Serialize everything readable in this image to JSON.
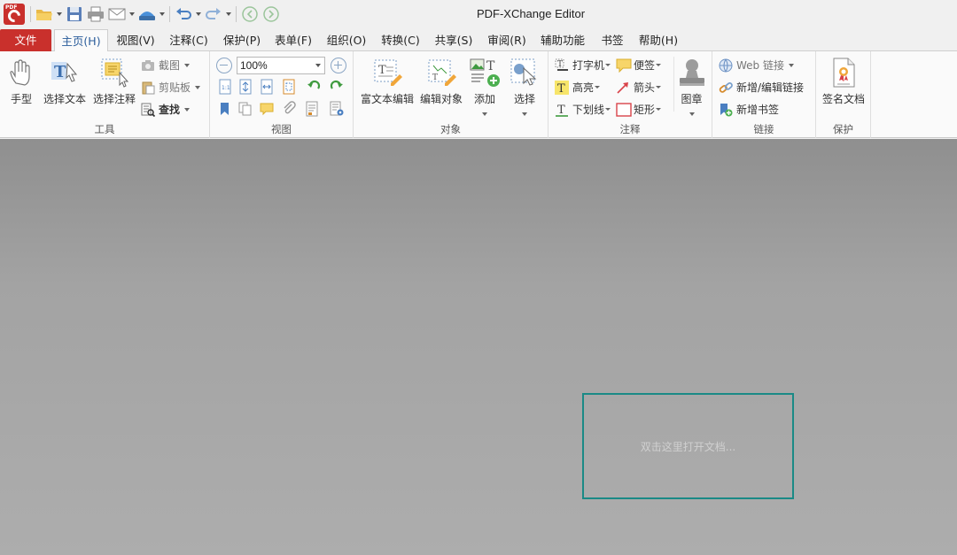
{
  "app": {
    "title": "PDF-XChange Editor",
    "logo_text": "PDF"
  },
  "quick_access": [
    {
      "name": "open-icon"
    },
    {
      "name": "save-icon"
    },
    {
      "name": "print-icon"
    },
    {
      "name": "email-icon"
    },
    {
      "name": "scan-icon"
    },
    {
      "name": "undo-icon"
    },
    {
      "name": "redo-icon"
    },
    {
      "name": "back-icon"
    },
    {
      "name": "forward-icon"
    }
  ],
  "menu_tabs": {
    "file": "文件",
    "home": "主页(H)",
    "view": "视图(V)",
    "comment": "注释(C)",
    "protect": "保护(P)",
    "form": "表单(F)",
    "organize": "组织(O)",
    "convert": "转换(C)",
    "share": "共享(S)",
    "review": "审阅(R)",
    "accessibility": "辅助功能",
    "bookmarks": "书签",
    "help": "帮助(H)"
  },
  "ribbon": {
    "tools": {
      "label": "工具",
      "hand": "手型",
      "select_text": "选择文本",
      "select_comment": "选择注释",
      "snapshot": "截图",
      "clipboard": "剪贴板",
      "find": "查找"
    },
    "view": {
      "label": "视图",
      "zoom": "100%"
    },
    "objects": {
      "label": "对象",
      "rich_text_edit": "富文本编辑",
      "edit_object": "编辑对象",
      "add": "添加",
      "select": "选择"
    },
    "comment": {
      "label": "注释",
      "typewriter": "打字机",
      "sticky_note": "便签",
      "highlight": "高亮",
      "arrow": "箭头",
      "underline": "下划线",
      "rectangle": "矩形",
      "stamp": "图章"
    },
    "links": {
      "label": "链接",
      "web_links": "Web 链接",
      "add_edit_link": "新增/编辑链接",
      "add_bookmark": "新增书签"
    },
    "protect": {
      "label": "保护",
      "sign_document": "签名文档"
    }
  },
  "document": {
    "open_hint": "双击这里打开文档..."
  },
  "colors": {
    "accent_red": "#c9302c",
    "active_tab_text": "#2a5c9a",
    "dropzone_border": "#1a8a86"
  }
}
